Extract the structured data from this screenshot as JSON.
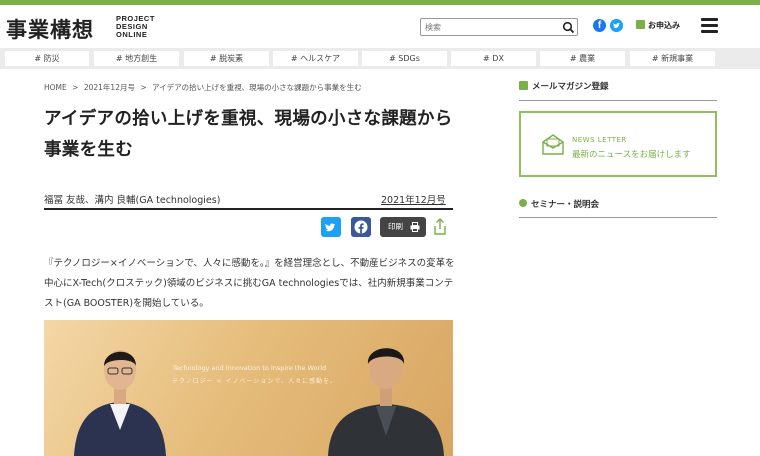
{
  "site": {
    "logo_text": "事業構想",
    "logo_sub": [
      "PROJECT",
      "DESIGN",
      "ONLINE"
    ],
    "accent_color": "#7bb048"
  },
  "header": {
    "search_placeholder": "検索",
    "facebook_icon": "facebook-icon",
    "twitter_icon": "twitter-icon",
    "apply_label": "お申込み",
    "menu_icon": "hamburger-icon"
  },
  "tags": [
    "# 防災",
    "# 地方創生",
    "# 脱炭素",
    "# ヘルスケア",
    "# SDGs",
    "# DX",
    "# 農業",
    "# 新規事業"
  ],
  "breadcrumb": [
    "HOME",
    ">",
    "2021年12月号",
    ">",
    "アイデアの拾い上げを重視、現場の小さな課題から事業を生む"
  ],
  "article": {
    "title": "アイデアの拾い上げを重視、現場の小さな課題から事業を生む",
    "authors": "福冨 友哉、溝内 良輔(GA technologies)",
    "date": "2021年12月号",
    "print_label": "印刷",
    "lead": "『テクノロジー×イノベーションで、人々に感動を。』を経営理念とし、不動産ビジネスの変革を中心にX-Tech(クロステック)領域のビジネスに挑むGA technologiesでは、社内新規事業コンテスト(GA BOOSTER)を開始している。",
    "photo_caption_en": "Technology and Innovation to Inspire the World",
    "photo_caption_jp": "テクノロジー × イノベーションで、人々に感動を。"
  },
  "sidebar": {
    "mail_heading": "メールマガジン登録",
    "newsletter_en": "NEWS LETTER",
    "newsletter_jp": "最新のニュースをお届けします",
    "seminar_heading": "セミナー・説明会"
  }
}
